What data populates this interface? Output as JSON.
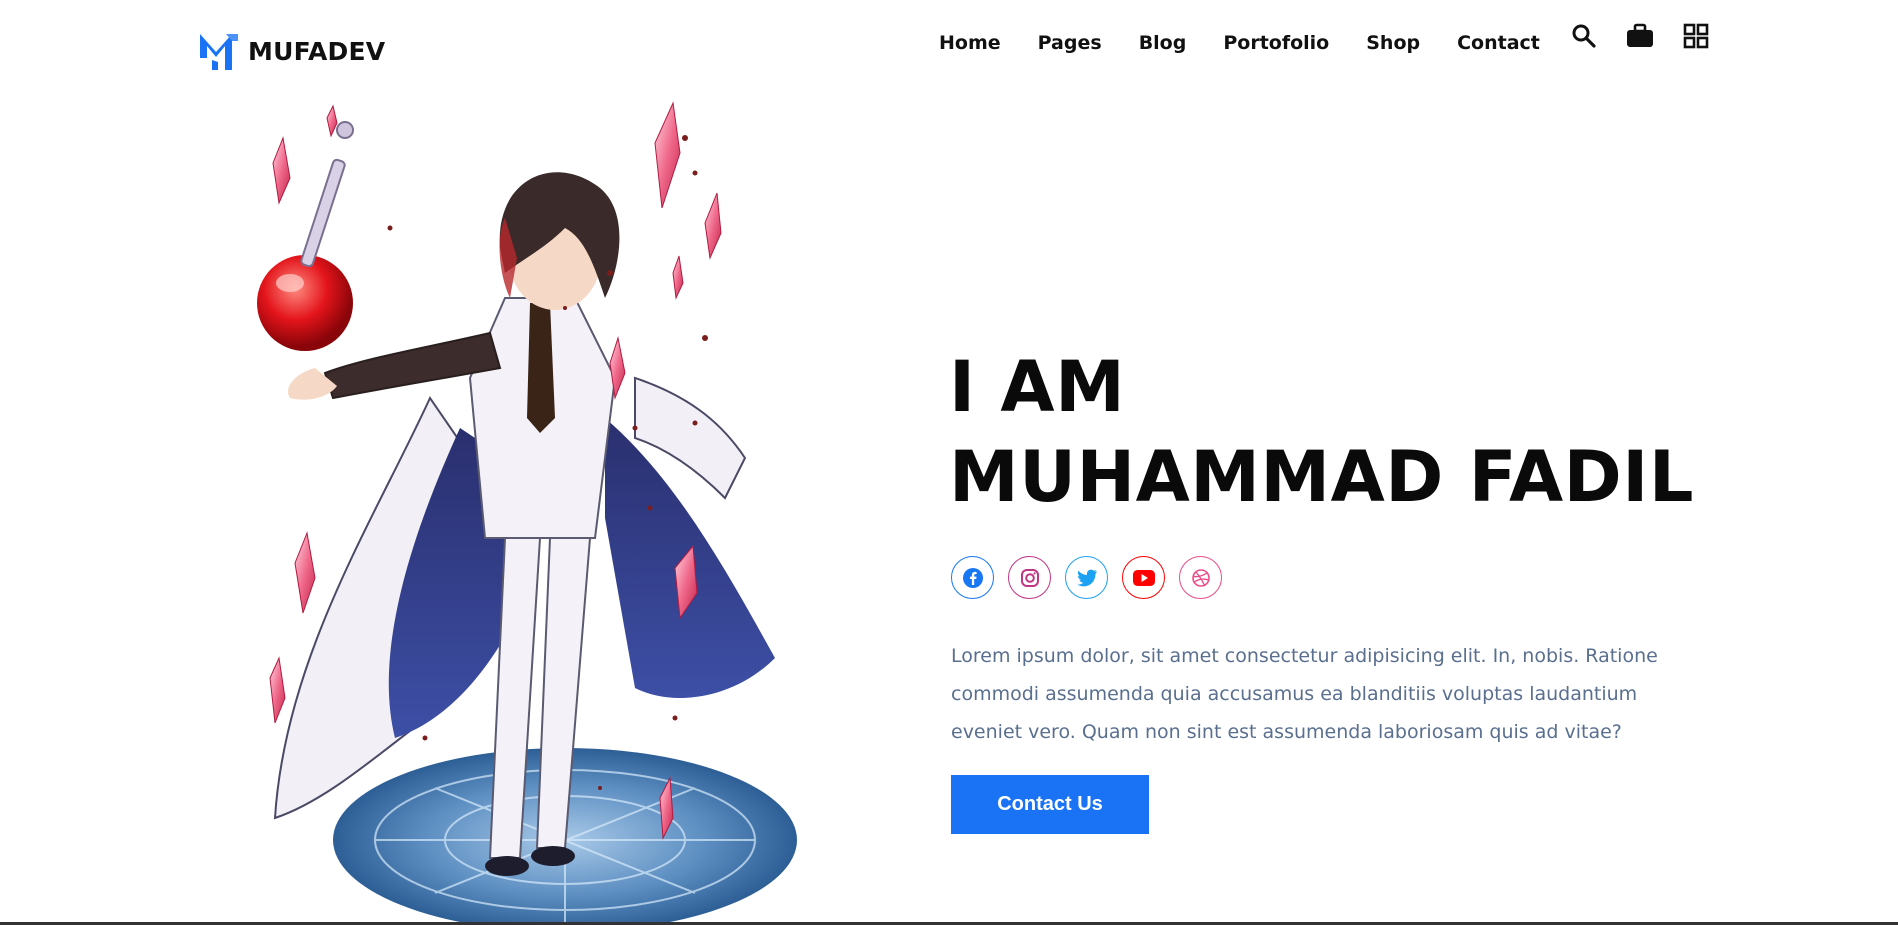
{
  "brand": {
    "name": "MUFADEV",
    "accent": "#1a73f5"
  },
  "nav": {
    "items": [
      {
        "label": "Home"
      },
      {
        "label": "Pages"
      },
      {
        "label": "Blog"
      },
      {
        "label": "Portofolio"
      },
      {
        "label": "Shop"
      },
      {
        "label": "Contact"
      }
    ],
    "icons": [
      "search-icon",
      "briefcase-icon",
      "grid-icon"
    ]
  },
  "hero": {
    "line1": "I AM",
    "line2": "MUHAMMAD FADIL",
    "description": "Lorem ipsum dolor, sit amet consectetur adipisicing elit. In, nobis. Ratione commodi assumenda quia accusamus ea blanditiis voluptas laudantium eveniet vero. Quam non sint est assumenda laboriosam quis ad vitae?",
    "cta_label": "Contact Us",
    "image": "anime-character-illustration"
  },
  "socials": [
    {
      "name": "facebook-icon",
      "color": "#1877f2"
    },
    {
      "name": "instagram-icon",
      "color": "#c13584"
    },
    {
      "name": "twitter-icon",
      "color": "#1da1f2"
    },
    {
      "name": "youtube-icon",
      "color": "#ff0000"
    },
    {
      "name": "dribbble-icon",
      "color": "#ea4c89"
    }
  ]
}
